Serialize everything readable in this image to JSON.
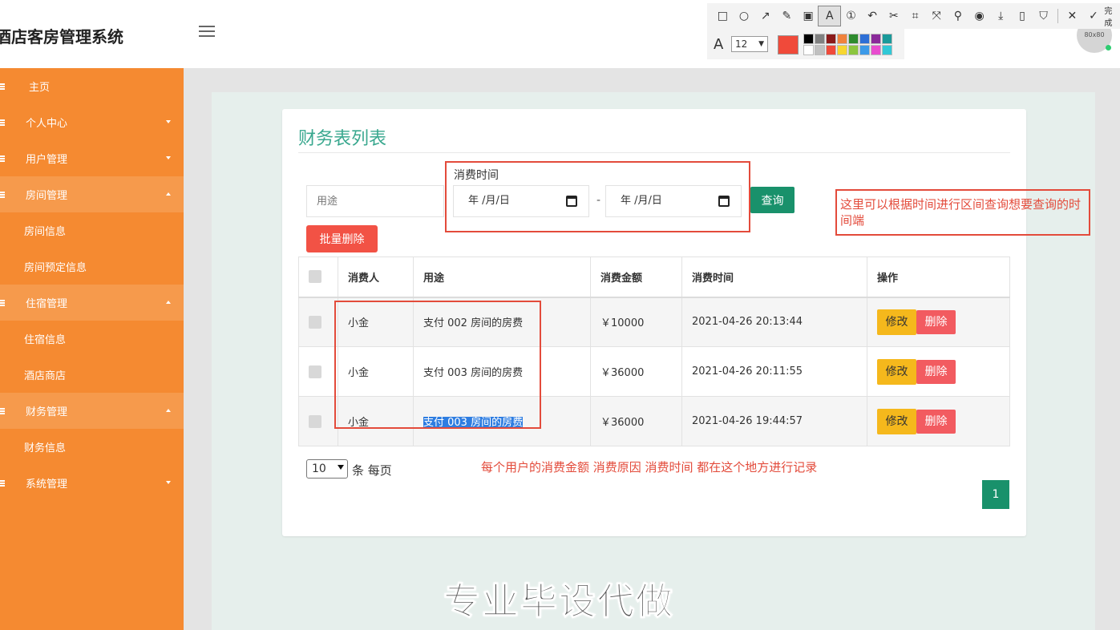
{
  "header": {
    "app_title": "酒店客房管理系统",
    "avatar_text": "80x80"
  },
  "snip_toolbar": {
    "tools": [
      "rectangle-tool",
      "ellipse-tool",
      "arrow-tool",
      "pen-tool",
      "mosaic-tool",
      "text-tool",
      "number-tool",
      "undo-tool",
      "cut-tool",
      "ocr-tool",
      "translate-tool",
      "pin-tool",
      "record-tool",
      "download-tool",
      "long-screenshot-tool",
      "bookmark-tool",
      "close-tool",
      "done-tool"
    ],
    "done_label": "完成",
    "font_size": "12",
    "current_color": "#f04a3a",
    "palette": [
      "#000000",
      "#808080",
      "#8b1a1a",
      "#f0823c",
      "#2e8b2e",
      "#2d6fd6",
      "#8a2a9a",
      "#1a9a9a",
      "#ffffff",
      "#c0c0c0",
      "#f04a3a",
      "#f7d630",
      "#8cc63f",
      "#3c9ae8",
      "#e84ccf",
      "#30c8d6"
    ]
  },
  "sidebar": {
    "items": [
      {
        "label": "主页"
      },
      {
        "label": "个人中心"
      },
      {
        "label": "用户管理"
      },
      {
        "label": "房间管理"
      },
      {
        "label": "房间信息"
      },
      {
        "label": "房间预定信息"
      },
      {
        "label": "住宿管理"
      },
      {
        "label": "住宿信息"
      },
      {
        "label": "酒店商店"
      },
      {
        "label": "财务管理"
      },
      {
        "label": "财务信息"
      },
      {
        "label": "系统管理"
      }
    ]
  },
  "page": {
    "title": "财务表列表",
    "search_placeholder": "用途",
    "date_label": "消费时间",
    "date_placeholder": "年 /月/日",
    "date_separator": "-",
    "query_button": "查询",
    "batch_delete_button": "批量删除"
  },
  "table": {
    "headers": [
      "消费人",
      "用途",
      "消费金额",
      "消费时间",
      "操作"
    ],
    "rows": [
      {
        "consumer": "小金",
        "purpose": "支付 002 房间的房费",
        "amount": "￥10000",
        "time": "2021-04-26 20:13:44"
      },
      {
        "consumer": "小金",
        "purpose": "支付 003 房间的房费",
        "amount": "￥36000",
        "time": "2021-04-26 20:11:55"
      },
      {
        "consumer": "小金",
        "purpose": "支付 003 房间的房费",
        "amount": "￥36000",
        "time": "2021-04-26 19:44:57"
      }
    ],
    "edit_label": "修改",
    "delete_label": "删除"
  },
  "pagination": {
    "page_size": "10",
    "per_page_text": "条 每页",
    "current_page": "1"
  },
  "annotations": {
    "date_note": "这里可以根据时间进行区间查询想要查询的时间端",
    "table_note": "每个用户的消费金额 消费原因 消费时间 都在这个地方进行记录",
    "watermark": "专业毕设代做"
  }
}
